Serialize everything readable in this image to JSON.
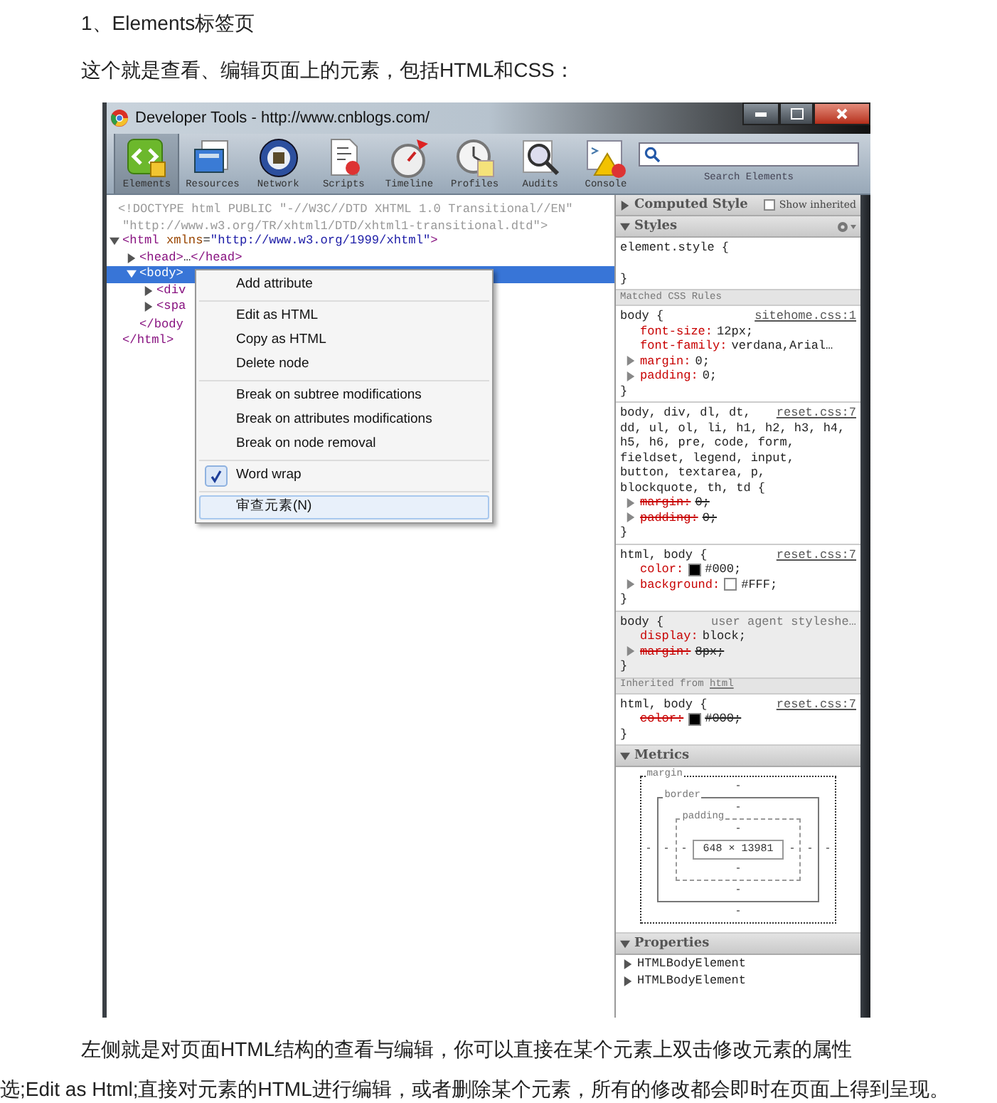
{
  "heading": "1、Elements标签页",
  "intro": "这个就是查看、编辑页面上的元素，包括HTML和CSS：",
  "devtools": {
    "title": "Developer Tools - http://www.cnblogs.com/",
    "tools": [
      {
        "label": "Elements",
        "selected": true
      },
      {
        "label": "Resources",
        "selected": false
      },
      {
        "label": "Network",
        "selected": false
      },
      {
        "label": "Scripts",
        "selected": false
      },
      {
        "label": "Timeline",
        "selected": false
      },
      {
        "label": "Profiles",
        "selected": false
      },
      {
        "label": "Audits",
        "selected": false
      },
      {
        "label": "Console",
        "selected": false
      }
    ],
    "search": {
      "label": "Search Elements"
    },
    "dom": [
      {
        "kind": "doctype",
        "lines": [
          "<!DOCTYPE html PUBLIC \"-//W3C//DTD XHTML 1.0 Transitional//EN\"",
          "\"http://www.w3.org/TR/xhtml1/DTD/xhtml1-transitional.dtd\">"
        ]
      },
      {
        "kind": "element",
        "expanded": true,
        "selected": false,
        "tokens": [
          {
            "kind": "tag",
            "text": "<html "
          },
          {
            "kind": "attr",
            "text": "xmlns"
          },
          {
            "kind": "plain",
            "text": "="
          },
          {
            "kind": "value",
            "text": "\"http://www.w3.org/1999/xhtml\""
          },
          {
            "kind": "tag",
            "text": ">"
          }
        ],
        "closing": "</html>",
        "children": [
          {
            "kind": "element",
            "expanded": false,
            "selected": false,
            "tokens": [
              {
                "kind": "tag",
                "text": "<head>"
              },
              {
                "kind": "plain",
                "text": "…"
              },
              {
                "kind": "tag",
                "text": "</head>"
              }
            ]
          },
          {
            "kind": "element",
            "expanded": true,
            "selected": true,
            "tokens": [
              {
                "kind": "tag",
                "text": "<body>"
              }
            ],
            "closing": "</body",
            "children": [
              {
                "kind": "element",
                "expanded": false,
                "selected": false,
                "tokens": [
                  {
                    "kind": "tag",
                    "text": "<div"
                  }
                ]
              },
              {
                "kind": "element",
                "expanded": false,
                "selected": false,
                "tokens": [
                  {
                    "kind": "tag",
                    "text": "<spa"
                  }
                ]
              }
            ]
          }
        ]
      }
    ],
    "context_menu": {
      "groups": [
        [
          {
            "label": "Add attribute",
            "checked": false,
            "selected": false
          }
        ],
        [
          {
            "label": "Edit as HTML",
            "checked": false,
            "selected": false
          },
          {
            "label": "Copy as HTML",
            "checked": false,
            "selected": false
          },
          {
            "label": "Delete node",
            "checked": false,
            "selected": false
          }
        ],
        [
          {
            "label": "Break on subtree modifications",
            "checked": false,
            "selected": false
          },
          {
            "label": "Break on attributes modifications",
            "checked": false,
            "selected": false
          },
          {
            "label": "Break on node removal",
            "checked": false,
            "selected": false
          }
        ],
        [
          {
            "label": "Word wrap",
            "checked": true,
            "selected": false
          }
        ],
        [
          {
            "label": "审查元素(N)",
            "checked": false,
            "selected": true
          }
        ]
      ]
    },
    "sidebar": {
      "computed": {
        "label": "Computed Style",
        "expanded": false,
        "checkbox": {
          "label": "Show inherited",
          "checked": false
        }
      },
      "styles": {
        "label": "Styles",
        "expanded": true
      },
      "blocks": [
        {
          "kind": "rule",
          "ua": false,
          "selector": "element.style {",
          "close": "}"
        },
        {
          "kind": "subheader",
          "text": "Matched CSS Rules"
        },
        {
          "kind": "rule",
          "ua": false,
          "selector": "body {",
          "source": "sitehome.css:1",
          "close": "}",
          "properties": [
            {
              "name": "font-size:",
              "value": "12px;",
              "overridden": false,
              "expandable": false
            },
            {
              "name": "font-family:",
              "value": "verdana,Arial…",
              "overridden": false,
              "expandable": false
            },
            {
              "name": "margin:",
              "value": "0;",
              "overridden": false,
              "expandable": true
            },
            {
              "name": "padding:",
              "value": "0;",
              "overridden": false,
              "expandable": true
            }
          ]
        },
        {
          "kind": "rule",
          "ua": false,
          "selector": [
            "body, div, dl, dt,",
            "dd, ul, ol, li, h1, h2, h3, h4,",
            "h5, h6, pre, code, form,",
            "fieldset, legend, input,",
            "button, textarea, p,",
            "blockquote, th, td {"
          ],
          "source": "reset.css:7",
          "close": "}",
          "properties": [
            {
              "name": "margin:",
              "value": "0;",
              "overridden": true,
              "expandable": true
            },
            {
              "name": "padding:",
              "value": "0;",
              "overridden": true,
              "expandable": true
            }
          ]
        },
        {
          "kind": "rule",
          "ua": false,
          "selector": "html, body {",
          "source": "reset.css:7",
          "close": "}",
          "properties": [
            {
              "name": "color:",
              "value": "#000;",
              "color": "#000000",
              "overridden": false,
              "expandable": false
            },
            {
              "name": "background:",
              "value": "#FFF;",
              "color": "#ffffff",
              "overridden": false,
              "expandable": true
            }
          ]
        },
        {
          "kind": "rule",
          "ua": true,
          "selector": "body {",
          "source": "user agent styleshe…",
          "close": "}",
          "properties": [
            {
              "name": "display:",
              "value": "block;",
              "overridden": false,
              "expandable": false
            },
            {
              "name": "margin:",
              "value": "8px;",
              "overridden": true,
              "expandable": true
            }
          ]
        },
        {
          "kind": "subheader",
          "text": "Inherited from ",
          "link": "html"
        },
        {
          "kind": "rule",
          "ua": false,
          "selector": "html, body {",
          "source": "reset.css:7",
          "close": "}",
          "properties": [
            {
              "name": "color:",
              "value": "#000;",
              "color": "#000000",
              "overridden": true,
              "expandable": false
            }
          ]
        }
      ],
      "metrics": {
        "label": "Metrics",
        "expanded": true,
        "labels": [
          "margin",
          "border",
          "padding"
        ],
        "top_values": [
          "-",
          "-",
          "-"
        ],
        "left_values": [
          "-",
          "-",
          "-"
        ],
        "content": "648 × 13981",
        "right_values": [
          "-",
          "-",
          "-"
        ],
        "bottom_values": [
          "-",
          "-",
          "-"
        ]
      },
      "properties": {
        "label": "Properties",
        "expanded": true,
        "items": [
          {
            "label": "HTMLBodyElement",
            "expanded": false
          },
          {
            "label": "HTMLBodyElement",
            "expanded": false
          }
        ]
      }
    }
  },
  "outro": [
    "左侧就是对页面HTML结构的查看与编辑，你可以直接在某个元素上双击修改元素的属性",
    "选;Edit as  Html;直接对元素的HTML进行编辑，或者删除某个元素，所有的修改都会即时在页面上得到呈现。"
  ]
}
